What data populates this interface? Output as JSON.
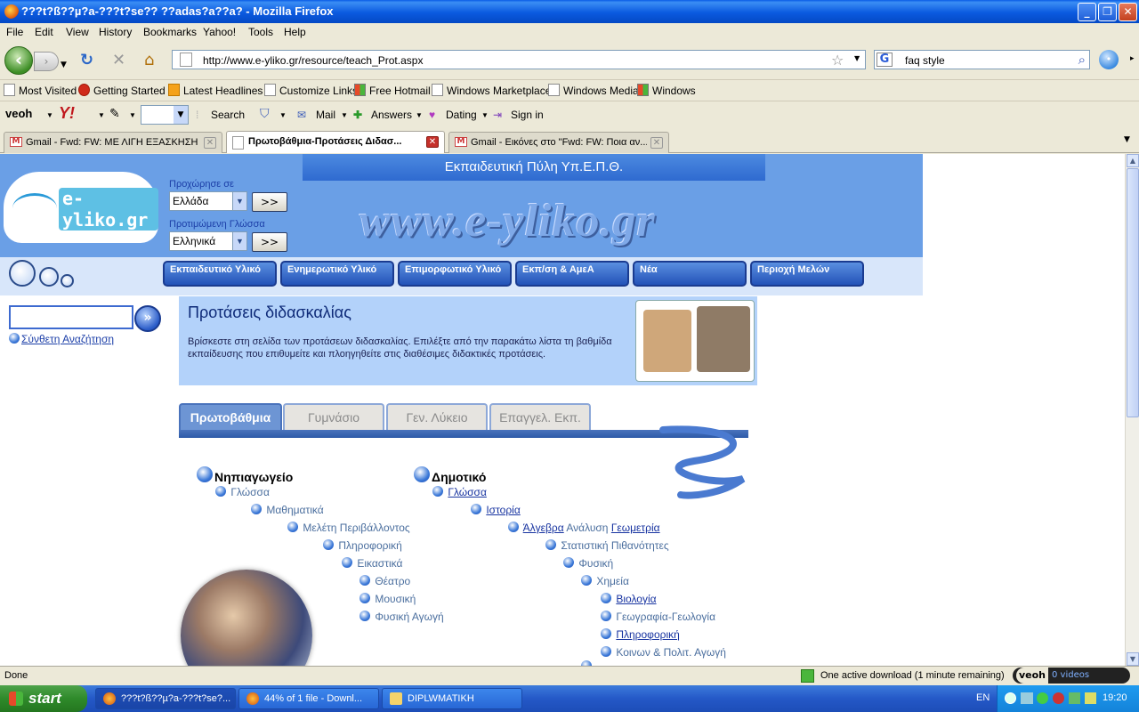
{
  "window": {
    "title": "???t?ß??µ?a-???t?se?? ??adas?a??a? - Mozilla Firefox"
  },
  "menu": [
    "File",
    "Edit",
    "View",
    "History",
    "Bookmarks",
    "Yahoo!",
    "Tools",
    "Help"
  ],
  "nav": {
    "url": "http://www.e-yliko.gr/resource/teach_Prot.aspx",
    "search_value": "faq style"
  },
  "bookmarks": [
    "Most Visited",
    "Getting Started",
    "Latest Headlines",
    "Customize Links",
    "Free Hotmail",
    "Windows Marketplace",
    "Windows Media",
    "Windows"
  ],
  "toolbar": {
    "veoh": "veoh",
    "yahoo": "Y!",
    "search": "Search",
    "mail": "Mail",
    "answers": "Answers",
    "dating": "Dating",
    "signin": "Sign in"
  },
  "tabs": [
    {
      "label": "Gmail - Fwd: FW: ΜΕ ΛΙΓΗ ΕΞΑΣΚΗΣΗ ..."
    },
    {
      "label": "Πρωτοβάθμια-Προτάσεις Διδασ..."
    },
    {
      "label": "Gmail - Εικόνες στο \"Fwd: FW: Ποια αν..."
    }
  ],
  "page": {
    "portal_title": "Εκπαιδευτική Πύλη Υπ.Ε.Π.Θ.",
    "logo_text": "e-yliko.gr",
    "site_url": "www.e-yliko.gr",
    "proceed_label": "Προχώρησε σε",
    "country_value": "Ελλάδα",
    "lang_label": "Προτιμώμενη Γλώσσα",
    "lang_value": "Ελληνικά",
    "go_label": ">>",
    "nav_buttons": [
      "Εκπαιδευτικό Υλικό",
      "Ενημερωτικό Υλικό",
      "Επιμορφωτικό Υλικό",
      "Εκπ/ση & ΑμεΑ",
      "Νέα",
      "Περιοχή Μελών"
    ],
    "advanced_search": "Σύνθετη Αναζήτηση",
    "intro_title": "Προτάσεις διδασκαλίας",
    "intro_text": "Βρίσκεστε στη σελίδα των προτάσεων διδασκαλίας. Επιλέξτε από την παρακάτω λίστα τη βαθμίδα εκπαίδευσης που επιθυμείτε και πλοηγηθείτε στις διαθέσιμες διδακτικές προτάσεις.",
    "level_tabs": [
      "Πρωτοβάθμια",
      "Γυμνάσιο",
      "Γεν. Λύκειο",
      "Επαγγελ. Εκπ."
    ],
    "kindergarten": {
      "title": "Νηπιαγωγείο",
      "items": [
        "Γλώσσα",
        "Μαθηματικά",
        "Μελέτη Περιβάλλοντος",
        "Πληροφορική",
        "Εικαστικά",
        "Θέατρο",
        "Μουσική",
        "Φυσική Αγωγή"
      ]
    },
    "primary": {
      "title": "Δημοτικό",
      "items": [
        "Γλώσσα",
        "Ιστορία",
        "Άλγεβρα",
        "Ανάλυση",
        "Γεωμετρία",
        "Στατιστική Πιθανότητες",
        "Φυσική",
        "Χημεία",
        "Βιολογία",
        "Γεωγραφία-Γεωλογία",
        "Πληροφορική",
        "Κοινων & Πολιτ. Αγωγή"
      ]
    }
  },
  "status": {
    "text": "Done",
    "download": "One active download (1 minute remaining)",
    "veoh_videos": "0  videos"
  },
  "taskbar": {
    "start": "start",
    "tasks": [
      "???t?ß??µ?a-???t?se?...",
      "44% of 1 file - Downl...",
      "DIPLWMATIKH"
    ],
    "lang": "EN",
    "time": "19:20"
  }
}
